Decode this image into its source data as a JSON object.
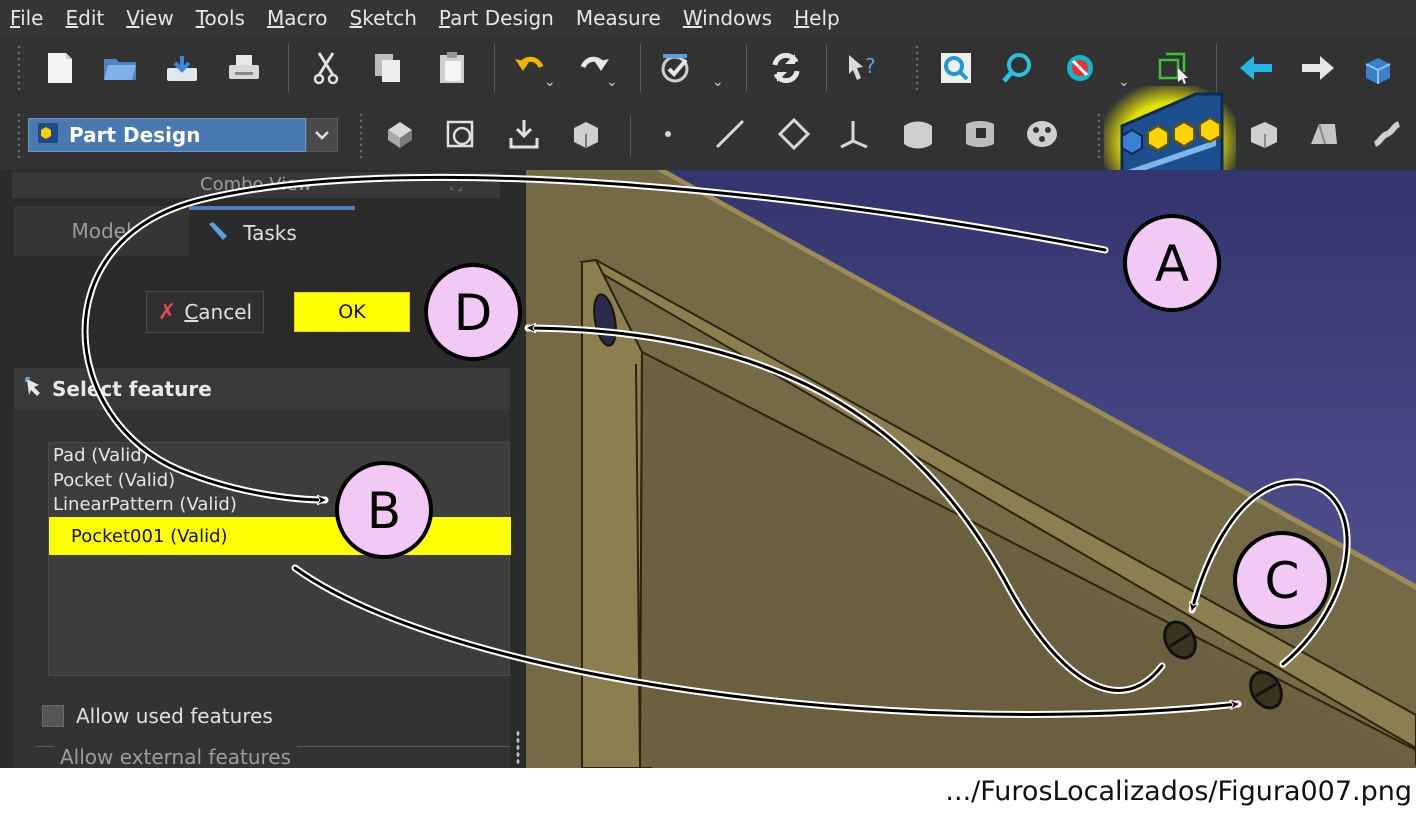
{
  "menubar": {
    "items": [
      {
        "label": "File",
        "u": "F",
        "rest": "ile"
      },
      {
        "label": "Edit",
        "u": "E",
        "rest": "dit"
      },
      {
        "label": "View",
        "u": "V",
        "rest": "iew"
      },
      {
        "label": "Tools",
        "u": "T",
        "rest": "ools"
      },
      {
        "label": "Macro",
        "u": "M",
        "rest": "acro"
      },
      {
        "label": "Sketch",
        "u": "S",
        "rest": "ketch"
      },
      {
        "label": "Part Design",
        "u": "P",
        "rest": "art Design"
      },
      {
        "label": "Measure",
        "u": "",
        "rest": "Measure"
      },
      {
        "label": "Windows",
        "u": "W",
        "rest": "indows"
      },
      {
        "label": "Help",
        "u": "H",
        "rest": "elp"
      }
    ]
  },
  "workbench": {
    "selected": "Part Design"
  },
  "combo_view": {
    "title": "Combo View"
  },
  "tabs": {
    "model": "Model",
    "tasks": "Tasks"
  },
  "buttons": {
    "cancel_u": "C",
    "cancel_rest": "ancel",
    "ok": "OK"
  },
  "select_feature": {
    "title": "Select feature",
    "features": [
      "Pad (Valid)",
      "Pocket (Valid)",
      "LinearPattern (Valid)"
    ],
    "selected": "Pocket001 (Valid)",
    "allow_used": "Allow used features",
    "allow_external": "Allow external features"
  },
  "callouts": {
    "a": "A",
    "b": "B",
    "c": "C",
    "d": "D"
  },
  "caption": ".../FurosLocalizados/Figura007.png",
  "colors": {
    "highlight": "#ffff00",
    "callout_fill": "#f2c8f5",
    "workbench": "#4a78b0",
    "model_face": "#7b6e45",
    "model_edge": "#8a7d4e"
  }
}
